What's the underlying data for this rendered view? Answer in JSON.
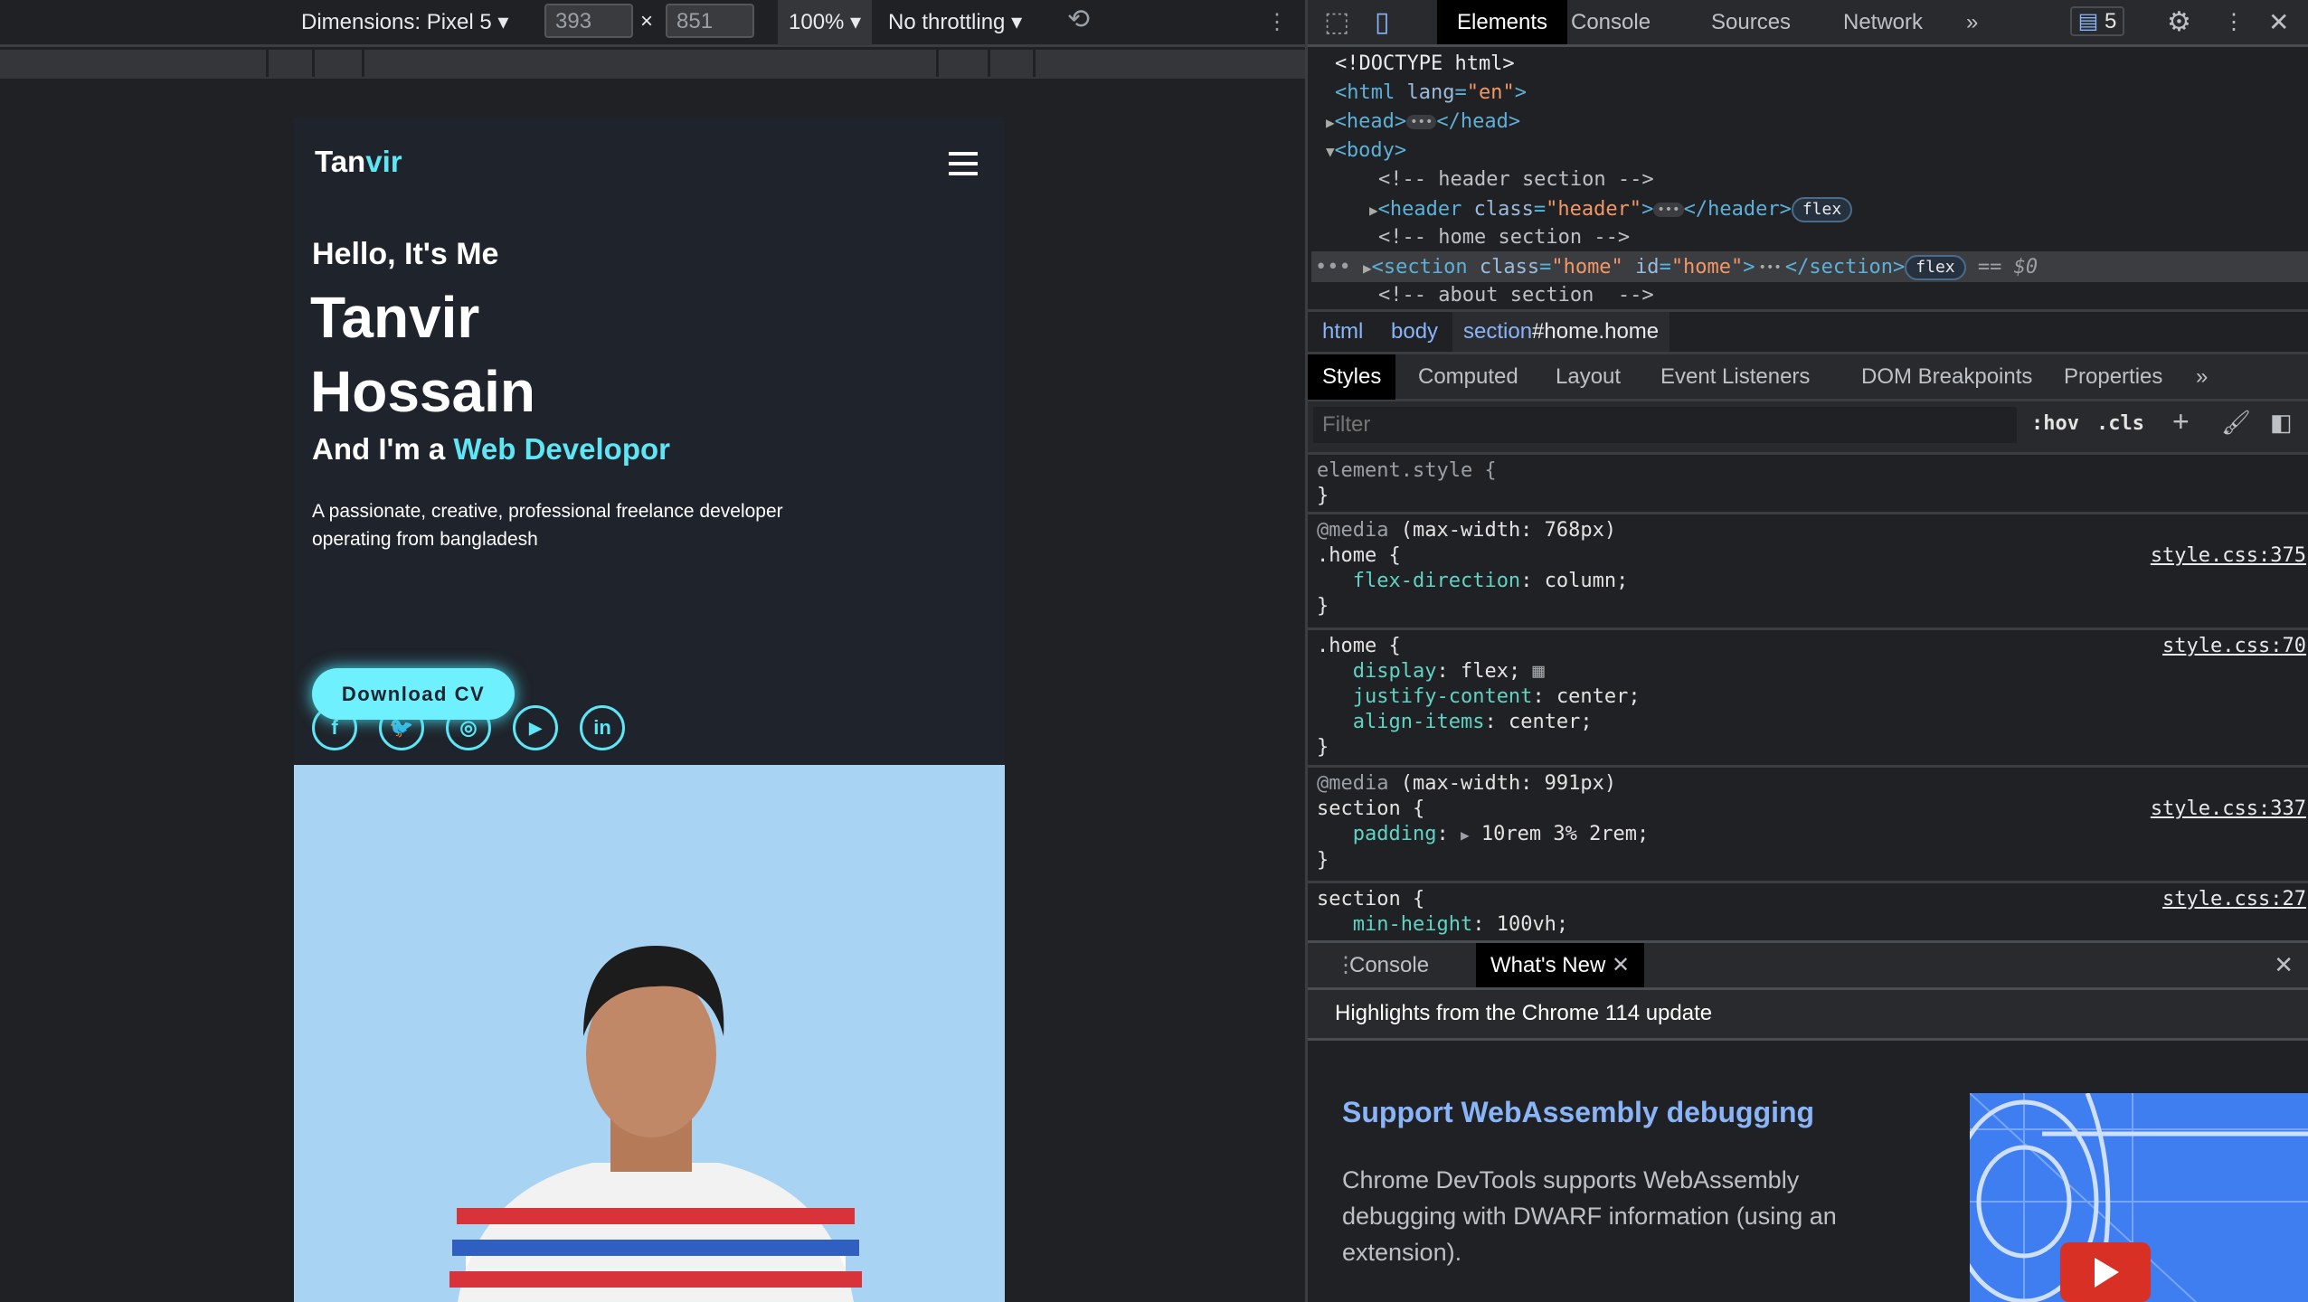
{
  "device_toolbar": {
    "dimensions_label": "Dimensions: Pixel 5",
    "width": "393",
    "height": "851",
    "times": "×",
    "zoom": "100%",
    "throttling": "No throttling"
  },
  "site": {
    "logo_a": "Tan",
    "logo_b": "vir",
    "hello": "Hello, It's Me",
    "name1": "Tanvir",
    "name2": "Hossain",
    "role_prefix": "And I'm a",
    "role": "Web Developor",
    "desc1": "A passionate, creative, professional freelance developer",
    "desc2": "operating from bangladesh",
    "social": [
      {
        "icon": "facebook-icon",
        "glyph": "f"
      },
      {
        "icon": "twitter-icon",
        "glyph": "🐦"
      },
      {
        "icon": "instagram-icon",
        "glyph": "◎"
      },
      {
        "icon": "youtube-icon",
        "glyph": "▶"
      },
      {
        "icon": "linkedin-icon",
        "glyph": "in"
      }
    ],
    "cta": "Download CV",
    "accent": "#5ee6f5"
  },
  "devtools": {
    "tabs": [
      "Elements",
      "Console",
      "Sources",
      "Network"
    ],
    "more": "»",
    "issues_count": "5",
    "dom": {
      "doctype": "<!DOCTYPE html>",
      "html_open": "<html",
      "lang_attr": "lang",
      "lang_val": "\"en\"",
      "head": "<head>",
      "head_close": "</head>",
      "body": "<body>",
      "c1": "<!-- header section -->",
      "header_tag": "<header",
      "class_attr": "class",
      "header_class": "\"header\"",
      "header_close": "</header>",
      "flex": "flex",
      "c2": "<!-- home section -->",
      "section_tag": "<section",
      "home_class": "\"home\"",
      "id_attr": "id",
      "home_id": "\"home\"",
      "section_close": "</section>",
      "eq": "== $0",
      "c3": "<!-- about section  -->"
    },
    "breadcrumb": [
      "html",
      "body",
      "section",
      "#home.home"
    ],
    "subtabs": [
      "Styles",
      "Computed",
      "Layout",
      "Event Listeners",
      "DOM Breakpoints",
      "Properties"
    ],
    "filter_placeholder": "Filter",
    "hov": ":hov",
    "cls": ".cls",
    "rules": [
      {
        "selector": "element.style {",
        "close": "}"
      },
      {
        "media": "@media",
        "media_q": "(max-width: 768px)",
        "selector": ".home {",
        "source": "style.css:375",
        "props": [
          {
            "n": "flex-direction",
            "v": "column;"
          }
        ],
        "close": "}"
      },
      {
        "selector": ".home {",
        "source": "style.css:70",
        "props": [
          {
            "n": "display",
            "v": "flex;"
          },
          {
            "n": "justify-content",
            "v": "center;"
          },
          {
            "n": "align-items",
            "v": "center;"
          }
        ],
        "close": "}"
      },
      {
        "media": "@media",
        "media_q": "(max-width: 991px)",
        "selector": "section {",
        "source": "style.css:337",
        "props": [
          {
            "n": "padding",
            "v": "10rem 3% 2rem;"
          }
        ],
        "close": "}"
      },
      {
        "selector": "section {",
        "source": "style.css:27",
        "props": [
          {
            "n": "min-height",
            "v": "100vh;"
          }
        ]
      }
    ],
    "drawer": {
      "tabs": [
        "Console",
        "What's New"
      ],
      "highlights": "Highlights from the Chrome 114 update",
      "heading": "Support WebAssembly debugging",
      "body": [
        "Chrome DevTools supports WebAssembly",
        "debugging with DWARF information (using an",
        "extension)."
      ]
    }
  }
}
